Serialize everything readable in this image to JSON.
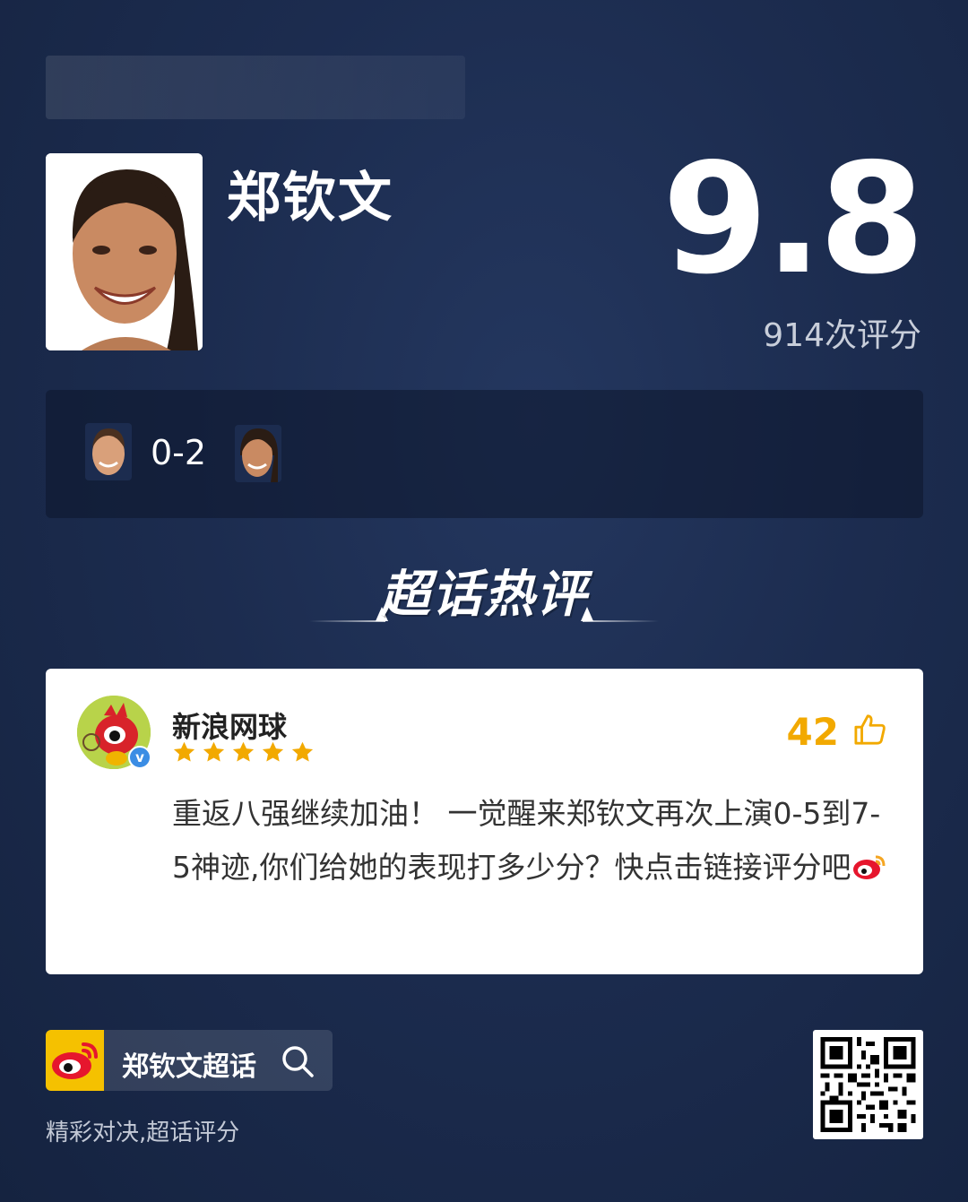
{
  "banner": {
    "text": ""
  },
  "player": {
    "name": "郑钦文",
    "score": "9.8",
    "rating_count": "914次评分"
  },
  "match": {
    "score": "0-2"
  },
  "section": {
    "title": "超话热评"
  },
  "comment": {
    "author": "新浪网球",
    "stars": 5,
    "likes": "42",
    "text": "重返八强继续加油！ 一觉醒来郑钦文再次上演0-5到7-5神迹,你们给她的表现打多少分？快点击链接评分吧"
  },
  "footer": {
    "topic_label": "郑钦文超话",
    "tagline": "精彩对决,超话评分"
  },
  "colors": {
    "background": "#1c2c4f",
    "like": "#f2a900",
    "star": "#f2a900",
    "weibo_yellow": "#f5c100",
    "weibo_red": "#e6162d"
  },
  "icons": [
    "weibo-logo-icon",
    "search-icon",
    "thumbs-up-icon",
    "star-icon",
    "verified-icon",
    "qr-code-icon"
  ]
}
